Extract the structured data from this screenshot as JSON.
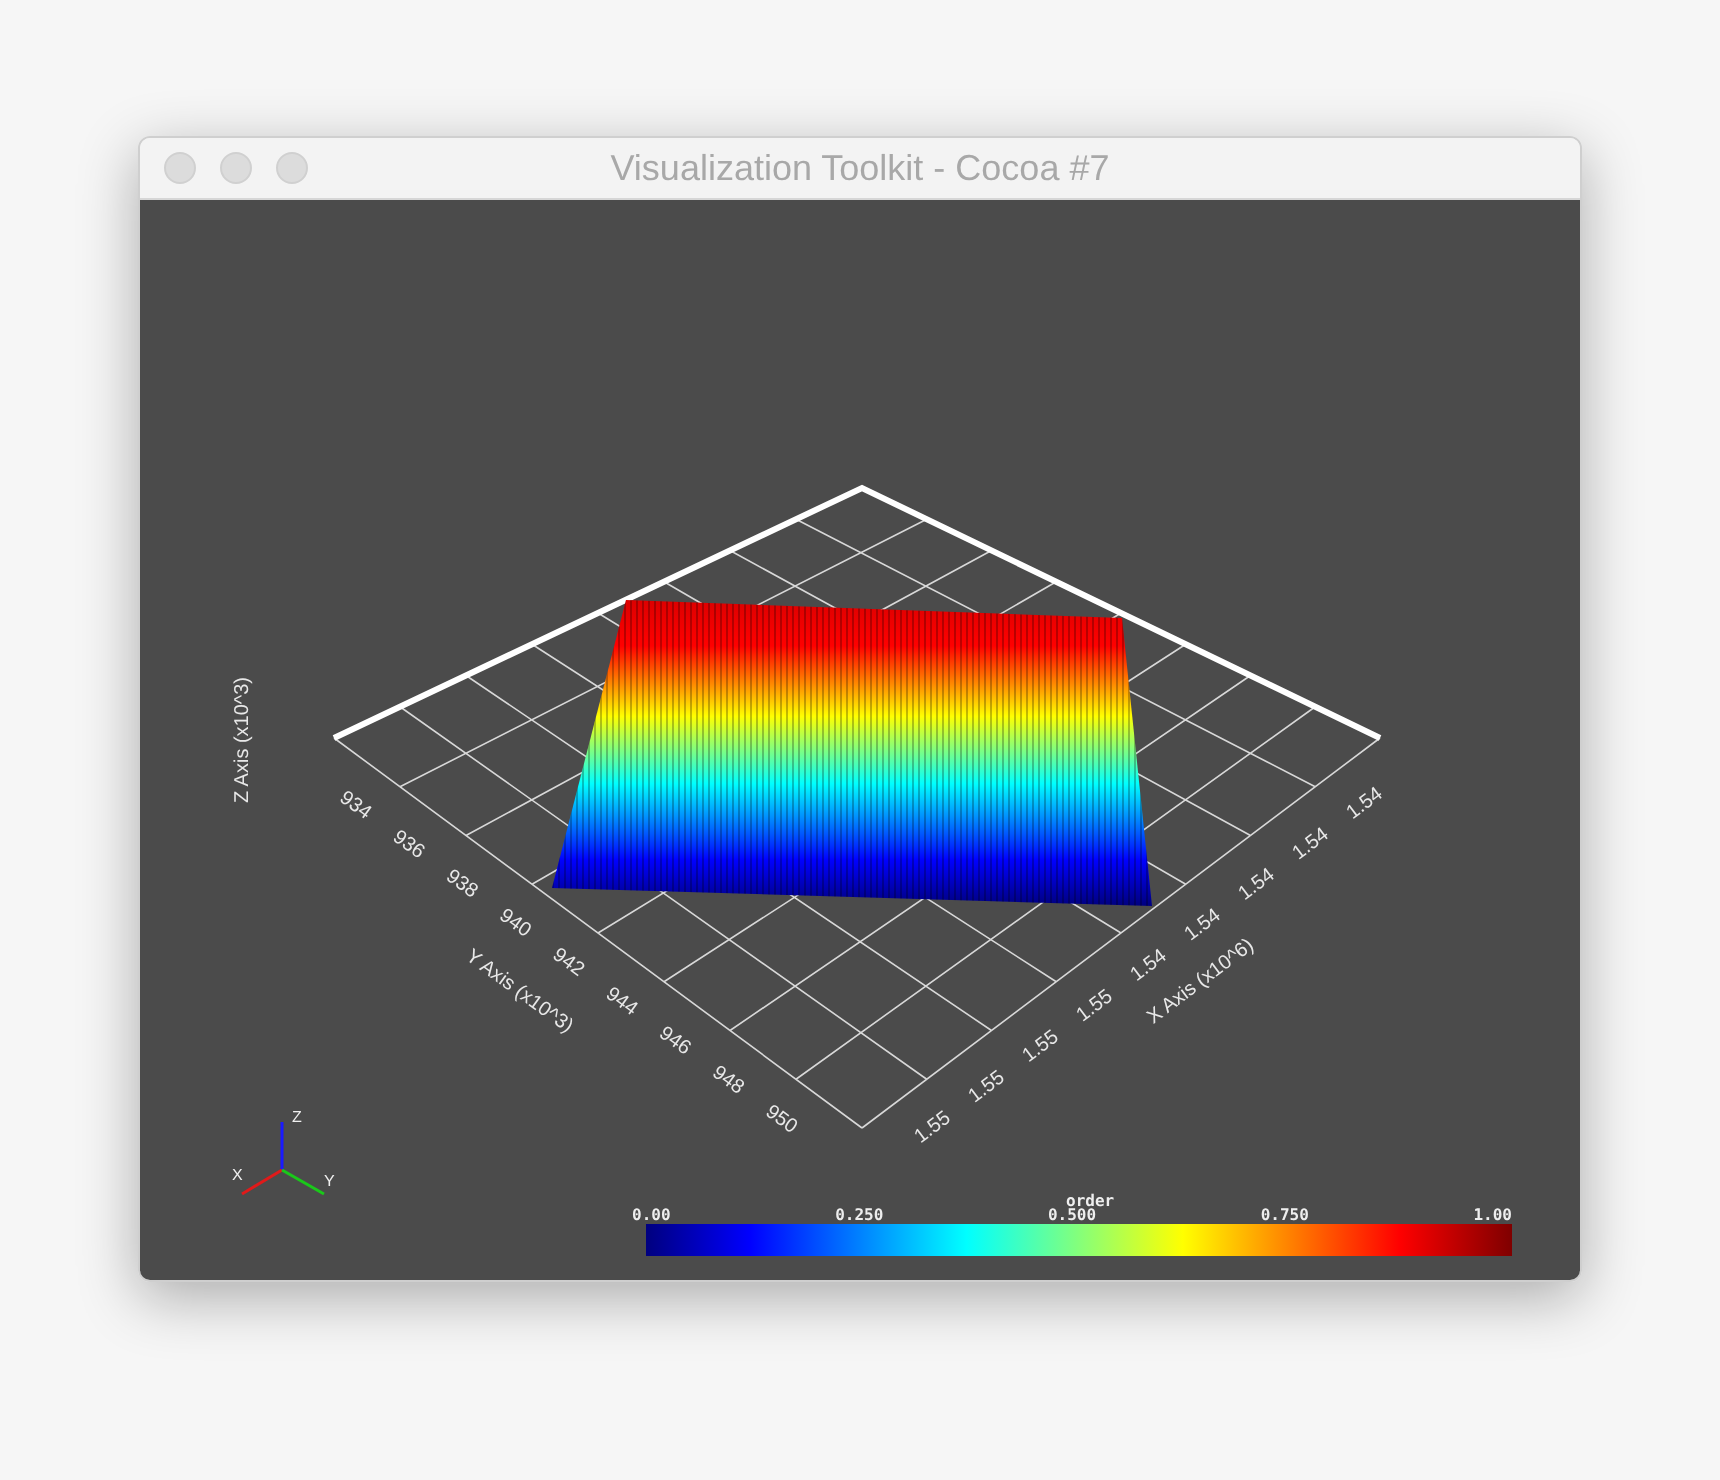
{
  "window": {
    "title": "Visualization Toolkit - Cocoa #7"
  },
  "scene": {
    "x_axis": {
      "title": "X Axis (x10^6)",
      "tick_labels": [
        "1.55",
        "1.55",
        "1.55",
        "1.55",
        "1.54",
        "1.54",
        "1.54",
        "1.54",
        "1.54"
      ]
    },
    "y_axis": {
      "title": "Y Axis (x10^3)",
      "tick_labels": [
        "934",
        "936",
        "938",
        "940",
        "942",
        "944",
        "946",
        "948",
        "950"
      ]
    },
    "z_axis": {
      "title": "Z Axis (x10^3)"
    }
  },
  "orientation_axes": [
    {
      "kind": "z",
      "label": "Z"
    },
    {
      "kind": "x",
      "label": "X"
    },
    {
      "kind": "y",
      "label": "Y"
    }
  ],
  "color_bar": {
    "title": "order",
    "tick_labels": [
      "0.00",
      "0.250",
      "0.500",
      "0.750",
      "1.00"
    ]
  }
}
